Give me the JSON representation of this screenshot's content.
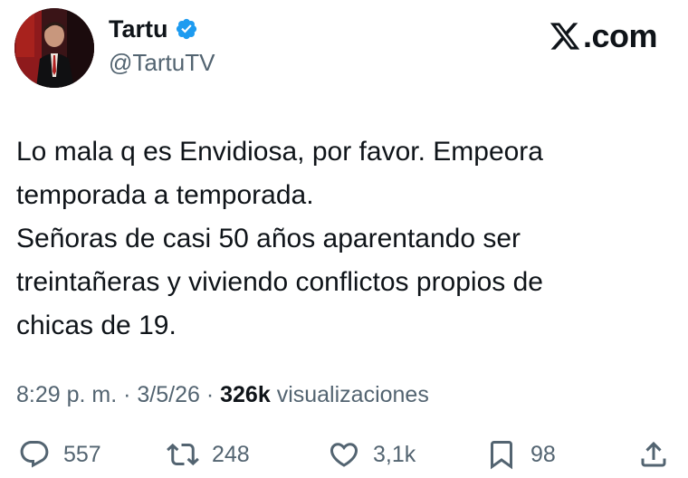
{
  "author": {
    "display_name": "Tartu",
    "handle": "@TartuTV",
    "verified_icon": "verified-badge-icon",
    "avatar_icon": "profile-photo"
  },
  "brand": {
    "label": ".com",
    "icon": "x-logo-icon"
  },
  "tweet": {
    "lines": [
      "Lo mala q es Envidiosa, por favor. Empeora",
      "temporada a temporada.",
      "Señoras de casi 50 años aparentando ser",
      "treintañeras y viviendo conflictos propios de",
      "chicas de 19."
    ]
  },
  "meta": {
    "time": "8:29 p. m.",
    "separator": " · ",
    "date": "3/5/26",
    "views_count": "326k",
    "views_label": " visualizaciones"
  },
  "actions": {
    "reply": {
      "count": "557",
      "icon": "reply-icon"
    },
    "repost": {
      "count": "248",
      "icon": "repost-icon"
    },
    "like": {
      "count": "3,1k",
      "icon": "heart-icon"
    },
    "bookmark": {
      "count": "98",
      "icon": "bookmark-icon"
    },
    "share": {
      "icon": "share-icon"
    }
  },
  "colors": {
    "text": "#0f1419",
    "secondary": "#536471",
    "verified": "#1d9bf0"
  }
}
